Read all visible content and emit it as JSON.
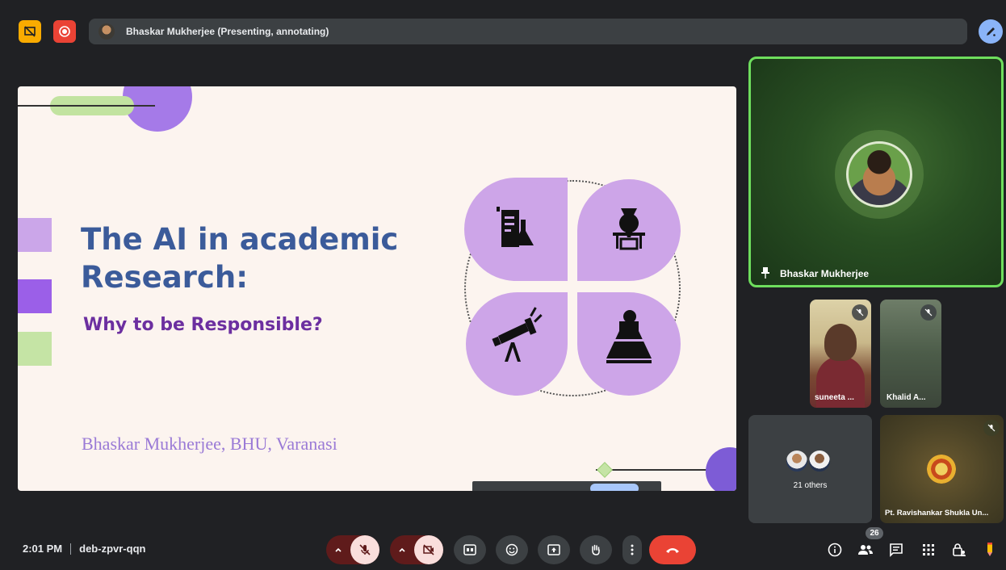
{
  "header": {
    "presenter_title": "Bhaskar Mukherjee (Presenting, annotating)"
  },
  "slide": {
    "title": "The AI in academic Research:",
    "subtitle": "Why to be Responsible?",
    "author": "Bhaskar Mukherjee, BHU, Varanasi"
  },
  "tiles": {
    "main_name": "Bhaskar Mukherjee",
    "small1_name": "suneeta ...",
    "small2_name": "Khalid A...",
    "others_label": "21 others",
    "ravi_name": "Pt. Ravishankar Shukla Un..."
  },
  "footer": {
    "time": "2:01 PM",
    "meeting_code": "deb-zpvr-qqn",
    "participant_count": "26"
  },
  "colors": {
    "accent_blue": "#8ab4f8",
    "speaking_green": "#6ede5d",
    "end_call_red": "#ea4335",
    "slide_title_blue": "#3b5b9a",
    "slide_sub_purple": "#6c2fa0"
  }
}
